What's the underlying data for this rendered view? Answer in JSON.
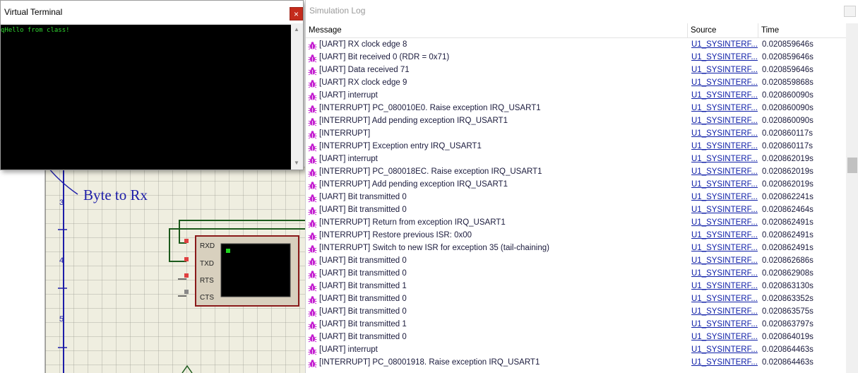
{
  "terminal": {
    "title": "Virtual Terminal",
    "close_glyph": "×",
    "output": "qHello from class!"
  },
  "schematic": {
    "annotation": "Byte to Rx",
    "ruler_marks": [
      "3",
      "4",
      "5"
    ],
    "pins": [
      "RXD",
      "TXD",
      "RTS",
      "CTS"
    ]
  },
  "log": {
    "title": "Simulation Log",
    "columns": [
      "Message",
      "Source",
      "Time"
    ],
    "icon": "bug-icon",
    "rows": [
      {
        "msg": "[UART] RX clock edge 8",
        "src": "U1_SYSINTERF...",
        "time": "0.020859646s"
      },
      {
        "msg": "[UART] Bit received 0 (RDR = 0x71)",
        "src": "U1_SYSINTERF...",
        "time": "0.020859646s"
      },
      {
        "msg": "[UART] Data received 71",
        "src": "U1_SYSINTERF...",
        "time": "0.020859646s"
      },
      {
        "msg": "[UART] RX clock edge 9",
        "src": "U1_SYSINTERF...",
        "time": "0.020859868s"
      },
      {
        "msg": "[UART] interrupt",
        "src": "U1_SYSINTERF...",
        "time": "0.020860090s"
      },
      {
        "msg": "[INTERRUPT] PC_080010E0. Raise exception IRQ_USART1",
        "src": "U1_SYSINTERF...",
        "time": "0.020860090s"
      },
      {
        "msg": "[INTERRUPT] Add pending exception IRQ_USART1",
        "src": "U1_SYSINTERF...",
        "time": "0.020860090s"
      },
      {
        "msg": "[INTERRUPT]",
        "src": "U1_SYSINTERF...",
        "time": "0.020860117s"
      },
      {
        "msg": "[INTERRUPT] Exception entry IRQ_USART1",
        "src": "U1_SYSINTERF...",
        "time": "0.020860117s"
      },
      {
        "msg": "[UART] interrupt",
        "src": "U1_SYSINTERF...",
        "time": "0.020862019s"
      },
      {
        "msg": "[INTERRUPT] PC_080018EC. Raise exception IRQ_USART1",
        "src": "U1_SYSINTERF...",
        "time": "0.020862019s"
      },
      {
        "msg": "[INTERRUPT] Add pending exception IRQ_USART1",
        "src": "U1_SYSINTERF...",
        "time": "0.020862019s"
      },
      {
        "msg": "[UART] Bit transmitted 0",
        "src": "U1_SYSINTERF...",
        "time": "0.020862241s"
      },
      {
        "msg": "[UART] Bit transmitted 0",
        "src": "U1_SYSINTERF...",
        "time": "0.020862464s"
      },
      {
        "msg": "[INTERRUPT] Return from exception IRQ_USART1",
        "src": "U1_SYSINTERF...",
        "time": "0.020862491s"
      },
      {
        "msg": "[INTERRUPT] Restore previous ISR: 0x00",
        "src": "U1_SYSINTERF...",
        "time": "0.020862491s"
      },
      {
        "msg": "[INTERRUPT] Switch to new ISR for exception 35 (tail-chaining)",
        "src": "U1_SYSINTERF...",
        "time": "0.020862491s"
      },
      {
        "msg": "[UART] Bit transmitted 0",
        "src": "U1_SYSINTERF...",
        "time": "0.020862686s"
      },
      {
        "msg": "[UART] Bit transmitted 0",
        "src": "U1_SYSINTERF...",
        "time": "0.020862908s"
      },
      {
        "msg": "[UART] Bit transmitted 1",
        "src": "U1_SYSINTERF...",
        "time": "0.020863130s"
      },
      {
        "msg": "[UART] Bit transmitted 0",
        "src": "U1_SYSINTERF...",
        "time": "0.020863352s"
      },
      {
        "msg": "[UART] Bit transmitted 0",
        "src": "U1_SYSINTERF...",
        "time": "0.020863575s"
      },
      {
        "msg": "[UART] Bit transmitted 1",
        "src": "U1_SYSINTERF...",
        "time": "0.020863797s"
      },
      {
        "msg": "[UART] Bit transmitted 0",
        "src": "U1_SYSINTERF...",
        "time": "0.020864019s"
      },
      {
        "msg": "[UART] interrupt",
        "src": "U1_SYSINTERF...",
        "time": "0.020864463s"
      },
      {
        "msg": "[INTERRUPT] PC_08001918. Raise exception IRQ_USART1",
        "src": "U1_SYSINTERF...",
        "time": "0.020864463s"
      }
    ]
  },
  "colors": {
    "terminal_text": "#2fd52f",
    "annotation": "#1c1ca8",
    "wire": "#1c5a1c",
    "bug_icon": "#c41fd0"
  }
}
